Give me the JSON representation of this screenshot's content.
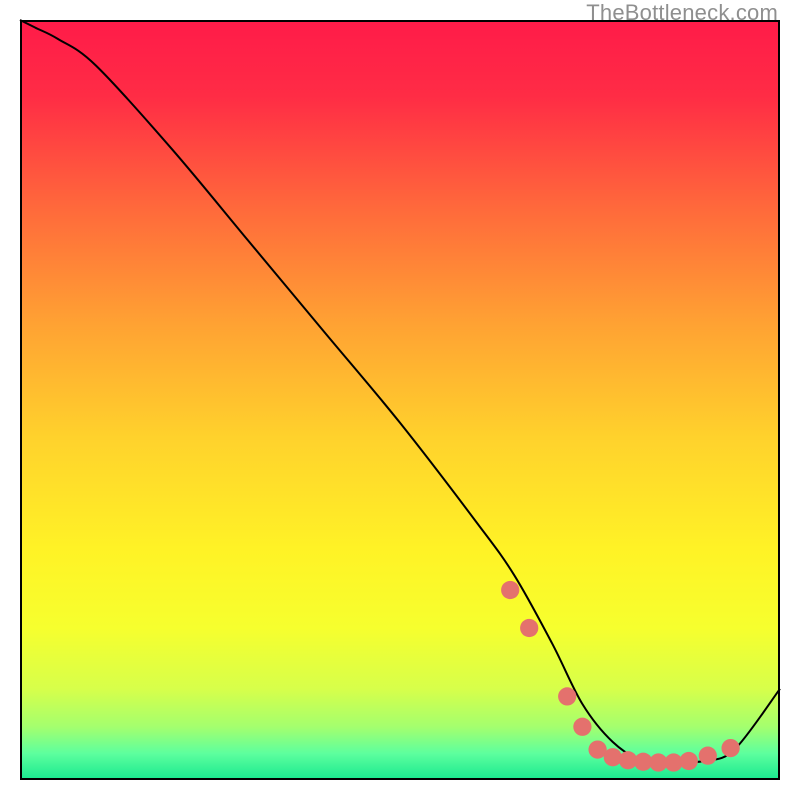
{
  "watermark": "TheBottleneck.com",
  "chart_data": {
    "type": "line",
    "title": "",
    "xlabel": "",
    "ylabel": "",
    "xlim": [
      0,
      100
    ],
    "ylim": [
      0,
      100
    ],
    "series": [
      {
        "name": "curve",
        "x": [
          0,
          2,
          5,
          10,
          20,
          30,
          40,
          50,
          60,
          65,
          70,
          74,
          78,
          82,
          86,
          90,
          94,
          100
        ],
        "y": [
          100,
          99,
          97.5,
          94,
          83,
          71,
          59,
          47,
          34,
          27,
          18,
          10,
          5,
          2.5,
          2.3,
          2.5,
          4,
          12
        ]
      }
    ],
    "markers": {
      "name": "dots",
      "color": "#e4716d",
      "x": [
        64.5,
        67,
        72,
        74,
        76,
        78,
        80,
        82,
        84,
        86,
        88,
        90.5,
        93.5
      ],
      "y": [
        25,
        20,
        11,
        7,
        4,
        3,
        2.6,
        2.4,
        2.3,
        2.3,
        2.5,
        3.2,
        4.2
      ]
    },
    "background_gradient": {
      "stops": [
        {
          "pos": 0.0,
          "color": "#ff1b49"
        },
        {
          "pos": 0.1,
          "color": "#ff2c45"
        },
        {
          "pos": 0.25,
          "color": "#ff6a3b"
        },
        {
          "pos": 0.4,
          "color": "#ffa233"
        },
        {
          "pos": 0.55,
          "color": "#ffd22c"
        },
        {
          "pos": 0.7,
          "color": "#fff326"
        },
        {
          "pos": 0.8,
          "color": "#f6ff2e"
        },
        {
          "pos": 0.88,
          "color": "#d7ff4a"
        },
        {
          "pos": 0.93,
          "color": "#a4ff6e"
        },
        {
          "pos": 0.965,
          "color": "#5dff9e"
        },
        {
          "pos": 1.0,
          "color": "#18e88f"
        }
      ]
    }
  }
}
